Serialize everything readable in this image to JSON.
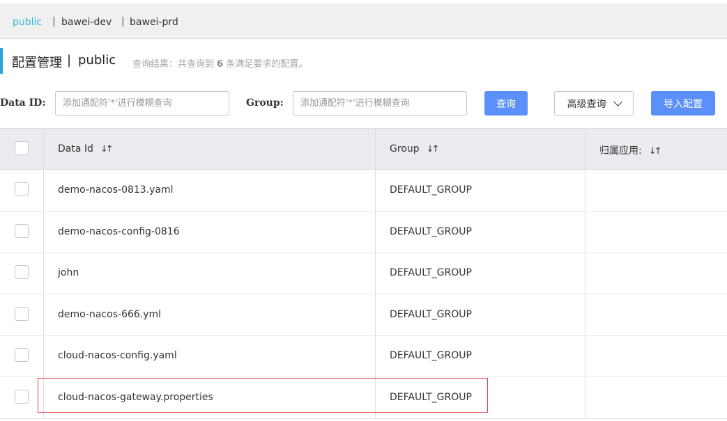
{
  "namespaces": [
    {
      "label": "public",
      "active": true
    },
    {
      "label": "bawei-dev",
      "active": false
    },
    {
      "label": "bawei-prd",
      "active": false
    }
  ],
  "namespace_separator": "|",
  "title": {
    "text": "配置管理",
    "separator": "|",
    "namespace": "public",
    "result_prefix": "查询结果：共查询到",
    "result_count": "6",
    "result_suffix": "条满足要求的配置。"
  },
  "search": {
    "data_id_label": "Data ID:",
    "data_id_placeholder": "添加通配符'*'进行模糊查询",
    "group_label": "Group:",
    "group_placeholder": "添加通配符'*'进行模糊查询",
    "query_button": "查询",
    "advanced_button": "高级查询",
    "import_button": "导入配置"
  },
  "table": {
    "headers": {
      "data_id": "Data Id",
      "group": "Group",
      "app": "归属应用:"
    },
    "sort_glyph": "↓↑",
    "rows": [
      {
        "data_id": "demo-nacos-0813.yaml",
        "group": "DEFAULT_GROUP",
        "app": ""
      },
      {
        "data_id": "demo-nacos-config-0816",
        "group": "DEFAULT_GROUP",
        "app": ""
      },
      {
        "data_id": "john",
        "group": "DEFAULT_GROUP",
        "app": ""
      },
      {
        "data_id": "demo-nacos-666.yml",
        "group": "DEFAULT_GROUP",
        "app": ""
      },
      {
        "data_id": "cloud-nacos-config.yaml",
        "group": "DEFAULT_GROUP",
        "app": ""
      },
      {
        "data_id": "cloud-nacos-gateway.properties",
        "group": "DEFAULT_GROUP",
        "app": ""
      }
    ]
  },
  "colors": {
    "primary": "#5b8ff9",
    "active_tab": "#33b4d9",
    "title_accent": "#29a3d9",
    "highlight": "#e03c3c"
  }
}
